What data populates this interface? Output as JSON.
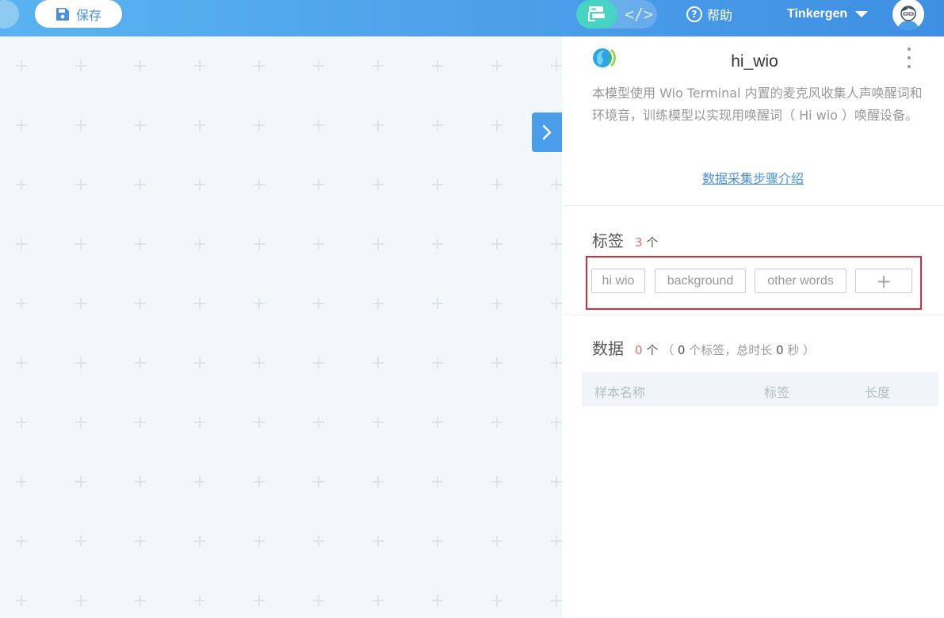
{
  "topbar": {
    "save_label": "保存",
    "help_label": "帮助",
    "user_name": "Tinkergen",
    "mode_code_glyph": "</>"
  },
  "model": {
    "name": "hi_wio",
    "description": "本模型使用 Wio Terminal 内置的麦克风收集人声唤醒词和环境音，训练模型以实现用唤醒词（ Hi wio ）唤醒设备。",
    "steps_link": "数据采集步骤介绍"
  },
  "labels_section": {
    "title": "标签",
    "count": "3",
    "unit": "个",
    "tags": [
      "hi wio",
      "background",
      "other words"
    ],
    "add_glyph": "+"
  },
  "data_section": {
    "title": "数据",
    "count": "0",
    "unit": "个",
    "open_paren": "（",
    "label_count": "0",
    "label_count_unit": "个标签，总时长",
    "total_duration": "0",
    "duration_unit": "秒",
    "close_paren": "）",
    "columns": [
      "样本名称",
      "标签",
      "长度"
    ]
  },
  "colors": {
    "topbar_start": "#5ab3f0",
    "topbar_end": "#3e8fe3",
    "accent": "#4a90e2",
    "teal": "#47d4c4",
    "count_red": "#e86b6b",
    "highlight_border": "#d92d3a",
    "canvas_bg": "#f3f7fb"
  },
  "icons": {
    "save": "floppy-disk-icon",
    "blocks": "blocks-icon",
    "help": "question-circle-icon",
    "caret": "caret-down-icon",
    "avatar": "user-avatar",
    "panel_toggle": "chevron-right-icon",
    "model_logo": "voice-wave-icon",
    "menu": "kebab-menu-icon"
  }
}
